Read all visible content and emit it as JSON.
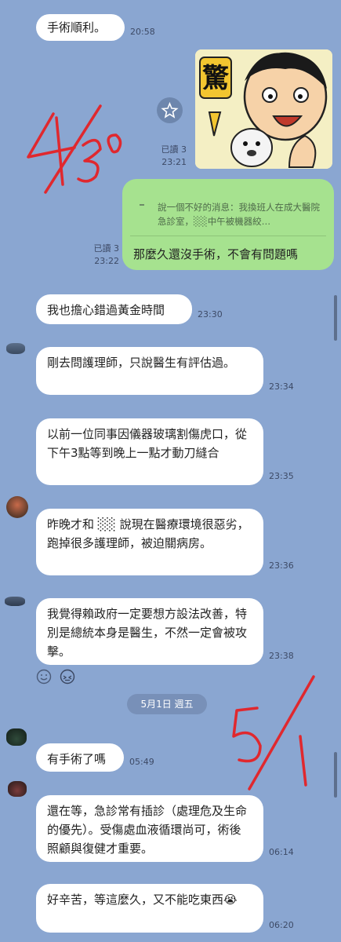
{
  "colors": {
    "background": "#8aa6d1",
    "incoming_bubble": "#ffffff",
    "outgoing_bubble": "#a6e28f",
    "handwriting": "#e0282e"
  },
  "messages": [
    {
      "text": "手術順利。",
      "time": "20:58"
    },
    {
      "text": "那麼久還沒手術，不會有問題嗎",
      "time": "23:22",
      "read": "已讀 3"
    },
    {
      "text": "我也擔心錯過黃金時間",
      "time": "23:30"
    },
    {
      "text": "剛去問護理師，只說醫生有評估過。",
      "time": "23:34"
    },
    {
      "text": "以前一位同事因儀器玻璃割傷虎口，從下午3點等到晚上一點才動刀縫合",
      "time": "23:35"
    },
    {
      "text": "昨晚才和 ░░ 說現在醫療環境很惡劣，跑掉很多護理師，被迫關病房。",
      "time": "23:36"
    },
    {
      "text": "我覺得賴政府一定要想方設法改善，特別是總統本身是醫生，不然一定會被攻擊。",
      "time": "23:38"
    },
    {
      "text": "有手術了嗎",
      "time": "05:49"
    },
    {
      "text": "還在等，急診常有插診（處理危及生命的優先）。受傷處血液循環尚可，術後照顧與復健才重要。",
      "time": "06:14"
    },
    {
      "text": "好辛苦，等這麼久，又不能吃東西😭",
      "time": "06:20"
    }
  ],
  "sticker": {
    "read": "已讀 3",
    "time": "23:21",
    "caption": "驚",
    "icon": "star-icon"
  },
  "quote": {
    "text": "說一個不好的消息：我換班人在成大醫院急診室，░░中午被機器絞…"
  },
  "date_separator": "5月1日 週五",
  "reactions": {
    "smile_icon": "smile-icon",
    "react_icon": "emoji-react-icon"
  },
  "annotations": {
    "top": "4/30",
    "bottom": "5/1"
  }
}
